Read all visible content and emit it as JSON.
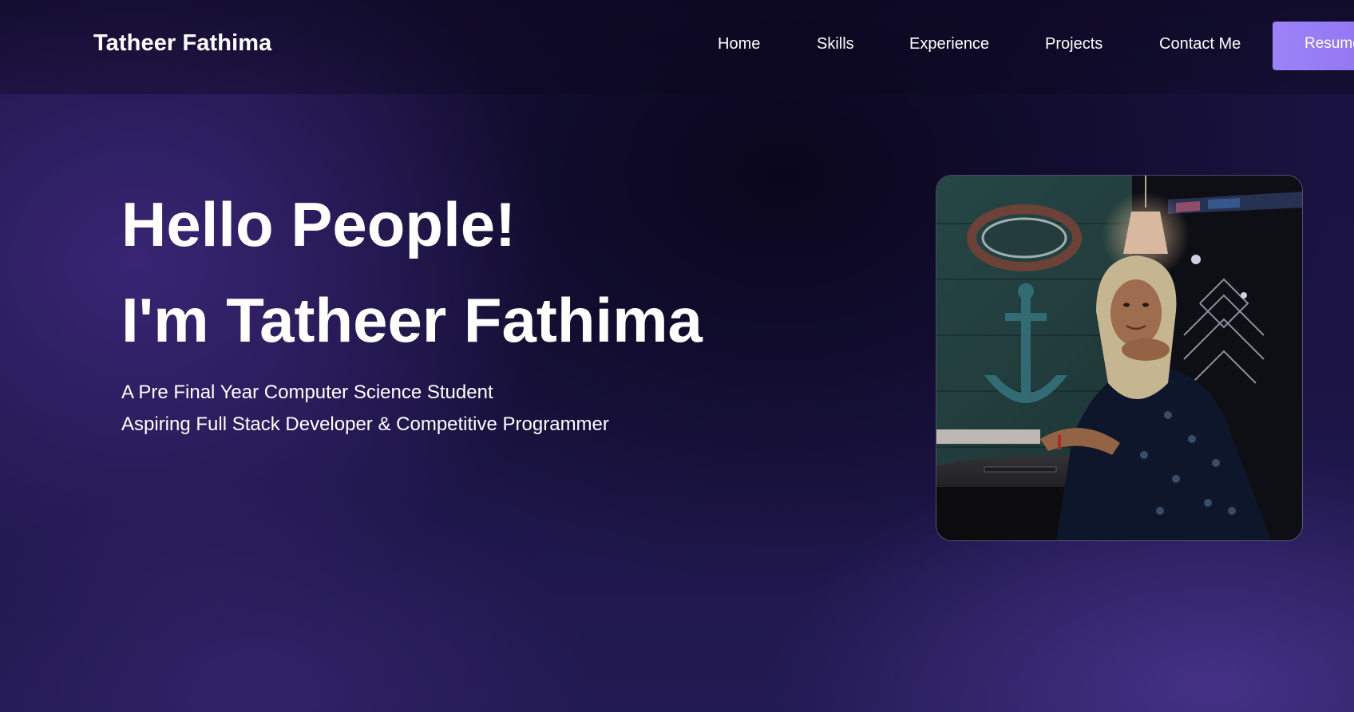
{
  "navbar": {
    "brand": "Tatheer Fathima",
    "links": [
      "Home",
      "Skills",
      "Experience",
      "Projects",
      "Contact Me"
    ],
    "resume_label": "Resume"
  },
  "hero": {
    "greeting": "Hello People!",
    "name_line": "I'm Tatheer Fathima",
    "subtitle_1": "A Pre Final Year Computer Science Student",
    "subtitle_2": "Aspiring Full Stack Developer & Competitive Programmer"
  },
  "colors": {
    "background": "#1b1444",
    "accent": "#9d83f7",
    "text": "#ffffff"
  }
}
